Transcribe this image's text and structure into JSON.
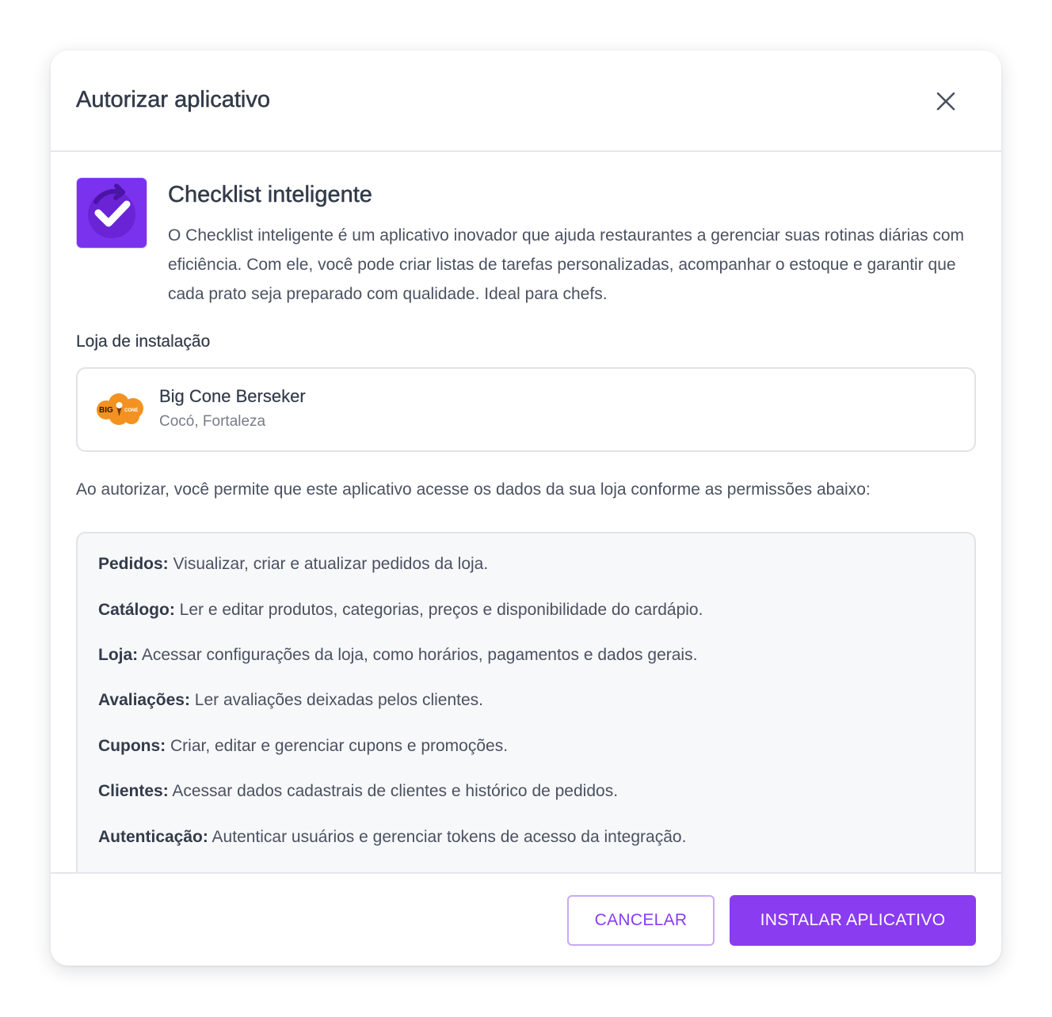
{
  "modal": {
    "title": "Autorizar aplicativo",
    "close_icon": "close-icon"
  },
  "app": {
    "icon": "checklist-refresh-icon",
    "icon_color": "#7a32ee",
    "name": "Checklist inteligente",
    "description": "O Checklist inteligente é um aplicativo inovador que ajuda restaurantes a gerenciar suas rotinas diárias com eficiência. Com ele, você pode criar listas de tarefas personalizadas, acompanhar o estoque e garantir que cada prato seja preparado com qualidade. Ideal para chefs."
  },
  "store": {
    "label": "Loja de instalação",
    "name": "Big Cone Berseker",
    "location": "Cocó, Fortaleza",
    "logo_text_left": "BIG",
    "logo_text_right": "CONE",
    "logo_color": "#f39221"
  },
  "consent_text": "Ao autorizar, você permite que este aplicativo acesse os dados da sua loja conforme as permissões abaixo:",
  "permissions": [
    {
      "name": "Pedidos:",
      "desc": "Visualizar, criar e atualizar pedidos da loja."
    },
    {
      "name": "Catálogo:",
      "desc": "Ler e editar produtos, categorias, preços e disponibilidade do cardápio."
    },
    {
      "name": "Loja:",
      "desc": "Acessar configurações da loja, como horários, pagamentos e dados gerais."
    },
    {
      "name": "Avaliações:",
      "desc": "Ler avaliações deixadas pelos clientes."
    },
    {
      "name": "Cupons:",
      "desc": "Criar, editar e gerenciar cupons e promoções."
    },
    {
      "name": "Clientes:",
      "desc": "Acessar dados cadastrais de clientes e histórico de pedidos."
    },
    {
      "name": "Autenticação:",
      "desc": "Autenticar usuários e gerenciar tokens de acesso da integração."
    }
  ],
  "footer": {
    "cancel_label": "CANCELAR",
    "install_label": "INSTALAR APLICATIVO"
  },
  "colors": {
    "accent": "#8a3cf0",
    "accent_border": "#c9a8f7",
    "text": "#333b4a"
  }
}
